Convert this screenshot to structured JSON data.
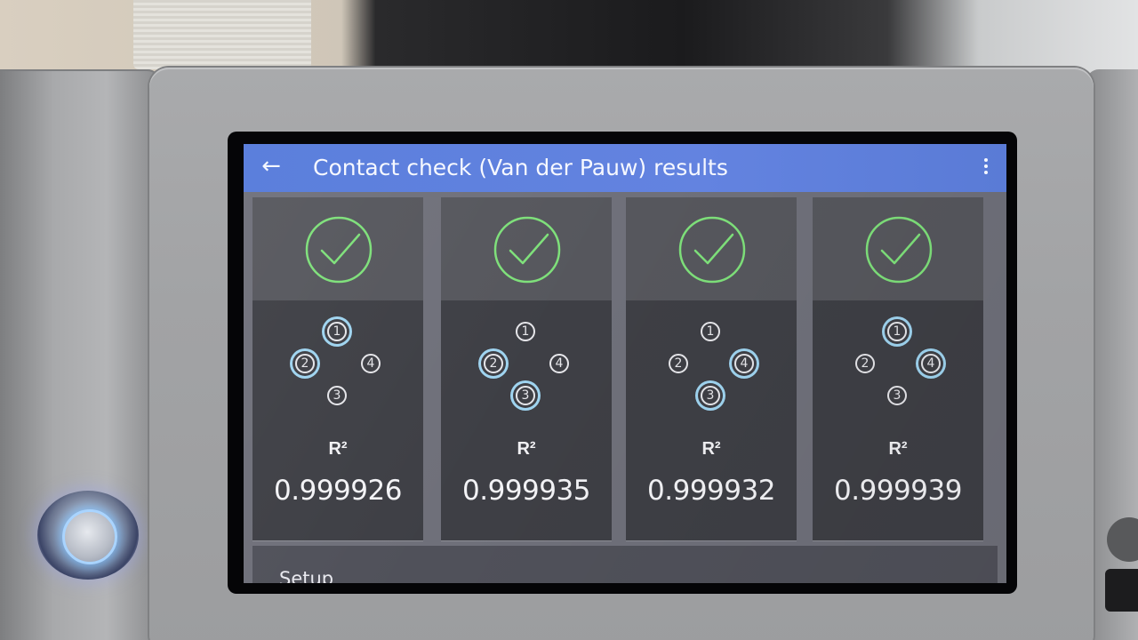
{
  "appbar": {
    "title": "Contact check (Van der Pauw) results",
    "back_icon": "arrow-left-icon",
    "menu_icon": "more-vertical-icon",
    "color": "#5b7fdc"
  },
  "cards": [
    {
      "status_icon": "check-circle-icon",
      "label": "R²",
      "value": "0.999926",
      "nodes": [
        {
          "num": "1",
          "active": true
        },
        {
          "num": "2",
          "active": true
        },
        {
          "num": "3",
          "active": false
        },
        {
          "num": "4",
          "active": false
        }
      ]
    },
    {
      "status_icon": "check-circle-icon",
      "label": "R²",
      "value": "0.999935",
      "nodes": [
        {
          "num": "1",
          "active": false
        },
        {
          "num": "2",
          "active": true
        },
        {
          "num": "3",
          "active": true
        },
        {
          "num": "4",
          "active": false
        }
      ]
    },
    {
      "status_icon": "check-circle-icon",
      "label": "R²",
      "value": "0.999932",
      "nodes": [
        {
          "num": "1",
          "active": false
        },
        {
          "num": "2",
          "active": false
        },
        {
          "num": "3",
          "active": true
        },
        {
          "num": "4",
          "active": true
        }
      ]
    },
    {
      "status_icon": "check-circle-icon",
      "label": "R²",
      "value": "0.999939",
      "nodes": [
        {
          "num": "1",
          "active": true
        },
        {
          "num": "2",
          "active": false
        },
        {
          "num": "3",
          "active": false
        },
        {
          "num": "4",
          "active": true
        }
      ]
    }
  ],
  "bottom": {
    "setup_label": "Setup"
  },
  "colors": {
    "check_green": "#7ee07a",
    "active_ring": "#9fd4f0",
    "power_led": "#a9d4ff"
  }
}
